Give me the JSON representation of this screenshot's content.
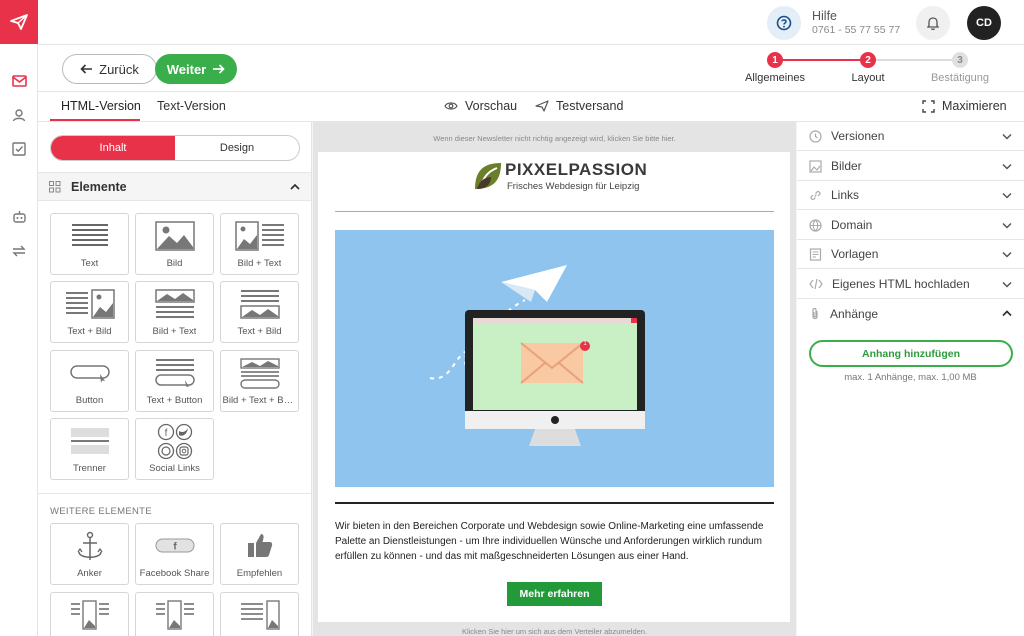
{
  "nav": {
    "icons": [
      "logo-paper-plane",
      "mail-icon",
      "user-icon",
      "checklist-icon",
      "robot-icon",
      "swap-icon"
    ]
  },
  "header": {
    "help_title": "Hilfe",
    "help_phone": "0761 - 55 77 55 77",
    "avatar_initials": "CD"
  },
  "actions": {
    "back_label": "Zurück",
    "next_label": "Weiter"
  },
  "steps": [
    {
      "num": "1",
      "label": "Allgemeines",
      "state": "done"
    },
    {
      "num": "2",
      "label": "Layout",
      "state": "active"
    },
    {
      "num": "3",
      "label": "Bestätigung",
      "state": "todo"
    }
  ],
  "tabs": {
    "html": "HTML-Version",
    "text": "Text-Version",
    "preview": "Vorschau",
    "test": "Testversand",
    "maximize": "Maximieren"
  },
  "left": {
    "seg_content": "Inhalt",
    "seg_design": "Design",
    "elements_title": "Elemente",
    "elements": [
      "Text",
      "Bild",
      "Bild + Text",
      "Text + Bild",
      "Bild + Text",
      "Text + Bild",
      "Button",
      "Text + Button",
      "Bild + Text + Bu...",
      "Trenner",
      "Social Links"
    ],
    "more_title": "WEITERE ELEMENTE",
    "more_elements": [
      "Anker",
      "Facebook Share",
      "Empfehlen"
    ]
  },
  "canvas": {
    "top_note": "Wenn dieser Newsletter nicht richtig angezeigt wird, klicken Sie bitte hier.",
    "brand_name": "PIXXELPASSION",
    "brand_tagline": "Frisches Webdesign für Leipzig",
    "body_text": "Wir bieten in den Bereichen Corporate und Webdesign sowie Online-Marketing eine umfassende Palette an Dienstleistungen - um Ihre individuellen Wünsche und Anforderungen wirklich rundum erfüllen zu können - und das mit maßgeschneiderten Lösungen aus einer Hand.",
    "cta_label": "Mehr erfahren",
    "bottom_note": "Klicken Sie hier um sich aus dem Verteiler abzumelden.",
    "mail_badge": "1"
  },
  "right": {
    "sections": [
      "Versionen",
      "Bilder",
      "Links",
      "Domain",
      "Vorlagen",
      "Eigenes HTML hochladen",
      "Anhänge"
    ],
    "attach_button": "Anhang hinzufügen",
    "attach_note": "max. 1 Anhänge, max. 1,00 MB"
  },
  "colors": {
    "brand_red": "#e8324a",
    "green": "#3aae4a",
    "hero_blue": "#8ec4ee"
  }
}
